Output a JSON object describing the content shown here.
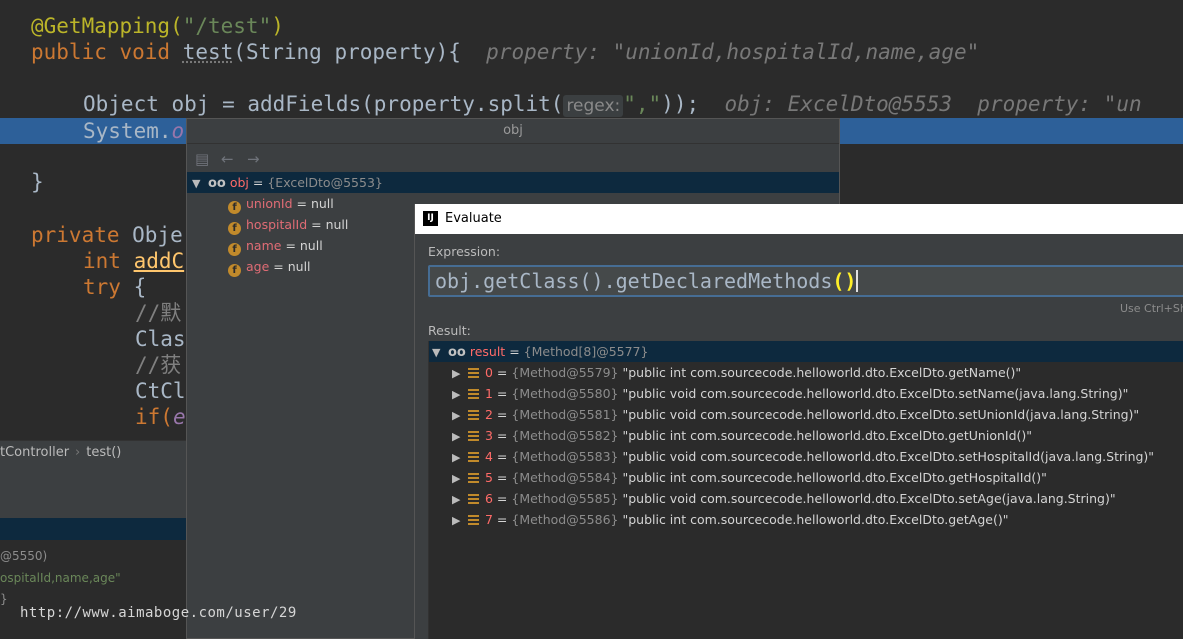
{
  "editor": {
    "line1_annotation": "@GetMapping(",
    "line1_string": "\"/test\"",
    "line1_close": ")",
    "line2_kw": "public void ",
    "line2_method": "test",
    "line2_rest": "(String property){",
    "line2_hint": "property: \"unionId,hospitalId,name,age\"",
    "line3_code": "Object obj = addFields(property.split(",
    "line3_param_hint": "regex:",
    "line3_string": "\",\"",
    "line3_close": "));",
    "line3_hint": "obj: ExcelDto@5553  property: \"un",
    "line4_code": "System.",
    "line4_tail": "o",
    "line5_code": "}",
    "line6_kw": "private ",
    "line6_rest": "Obje",
    "line7_kw": "int ",
    "line7_rest": "addC",
    "line8_kw": "try ",
    "line8_rest": "{",
    "line9_comment": "//默",
    "line10_code": "Clas",
    "line11_comment": "//获",
    "line12_code": "CtCl",
    "line13_kw": "if(",
    "line13_rest": "e"
  },
  "breadcrumb": {
    "item1": "tController",
    "item2": "test()",
    "separator": "›"
  },
  "debug_panel": {
    "line1": "@5550)",
    "line2": "ospitalId,name,age\"",
    "line3": "}"
  },
  "watermark": "http://www.aimaboge.com/user/29",
  "obj_popup": {
    "title": "obj",
    "root": {
      "name": "obj",
      "value": "{ExcelDto@5553}"
    },
    "fields": [
      {
        "name": "unionId",
        "value": "= null"
      },
      {
        "name": "hospitalId",
        "value": "= null"
      },
      {
        "name": "name",
        "value": "= null"
      },
      {
        "name": "age",
        "value": "= null"
      }
    ]
  },
  "evaluate": {
    "title": "Evaluate",
    "logo": "IJ",
    "expression_label": "Expression:",
    "expression_main": "obj.getClass().getDeclaredMethods",
    "expression_parens": "()",
    "hint": "Use Ctrl+Shi",
    "result_label": "Result:",
    "result_root": {
      "name": "result",
      "value": "{Method[8]@5577}"
    },
    "items": [
      {
        "index": "0",
        "ref": "{Method@5579}",
        "value": "\"public int com.sourcecode.helloworld.dto.ExcelDto.getName()\""
      },
      {
        "index": "1",
        "ref": "{Method@5580}",
        "value": "\"public void com.sourcecode.helloworld.dto.ExcelDto.setName(java.lang.String)\""
      },
      {
        "index": "2",
        "ref": "{Method@5581}",
        "value": "\"public void com.sourcecode.helloworld.dto.ExcelDto.setUnionId(java.lang.String)\""
      },
      {
        "index": "3",
        "ref": "{Method@5582}",
        "value": "\"public int com.sourcecode.helloworld.dto.ExcelDto.getUnionId()\""
      },
      {
        "index": "4",
        "ref": "{Method@5583}",
        "value": "\"public void com.sourcecode.helloworld.dto.ExcelDto.setHospitalId(java.lang.String)\""
      },
      {
        "index": "5",
        "ref": "{Method@5584}",
        "value": "\"public int com.sourcecode.helloworld.dto.ExcelDto.getHospitalId()\""
      },
      {
        "index": "6",
        "ref": "{Method@5585}",
        "value": "\"public void com.sourcecode.helloworld.dto.ExcelDto.setAge(java.lang.String)\""
      },
      {
        "index": "7",
        "ref": "{Method@5586}",
        "value": "\"public int com.sourcecode.helloworld.dto.ExcelDto.getAge()\""
      }
    ]
  },
  "icons": {
    "expand": "▼",
    "collapse": "▶",
    "watch": "oo",
    "back": "←",
    "forward": "→",
    "field": "f"
  },
  "colors": {
    "selection": "#2d6099",
    "tree_selection": "#0d293e",
    "editor_bg": "#2b2b2b",
    "panel_bg": "#3c3f41"
  }
}
